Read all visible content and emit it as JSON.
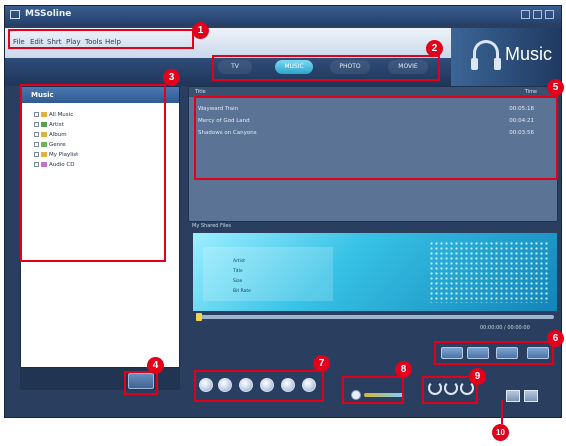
{
  "window": {
    "title": "MSSoline"
  },
  "menu": {
    "items": [
      "File",
      "Edit",
      "Shrt",
      "Play",
      "Tools",
      "Help"
    ]
  },
  "brand": {
    "label": "Music"
  },
  "tabs": [
    {
      "label": "TV"
    },
    {
      "label": "MUSIC"
    },
    {
      "label": "PHOTO"
    },
    {
      "label": "MOVIE"
    }
  ],
  "library": {
    "title": "Music",
    "items": [
      "All Music",
      "Artist",
      "Album",
      "Genre",
      "My Playlist",
      "Audio CD"
    ]
  },
  "playlist": {
    "header_left": "Title",
    "header_right": "Time",
    "rows": [
      {
        "name": "Wayward Train",
        "time": "00:05:18"
      },
      {
        "name": "Mercy of God Land",
        "time": "00:04:21"
      },
      {
        "name": "Shadows on Canyons",
        "time": "00:03:56"
      }
    ]
  },
  "visualizer": {
    "label": "My Shared Files",
    "lines": [
      "Artist",
      "Title",
      "Size",
      "Bit Rate"
    ]
  },
  "timecode": "00:00:00 / 00:00:00",
  "callouts": [
    "1",
    "2",
    "3",
    "4",
    "5",
    "6",
    "7",
    "8",
    "9",
    "10"
  ],
  "icons": {
    "app": "app-icon",
    "headphones": "headphones-icon",
    "grid": "grid-icon"
  },
  "colors": {
    "annotation": "#e3001b",
    "accent": "#2aa5cc",
    "panel": "#2a3f5f"
  }
}
